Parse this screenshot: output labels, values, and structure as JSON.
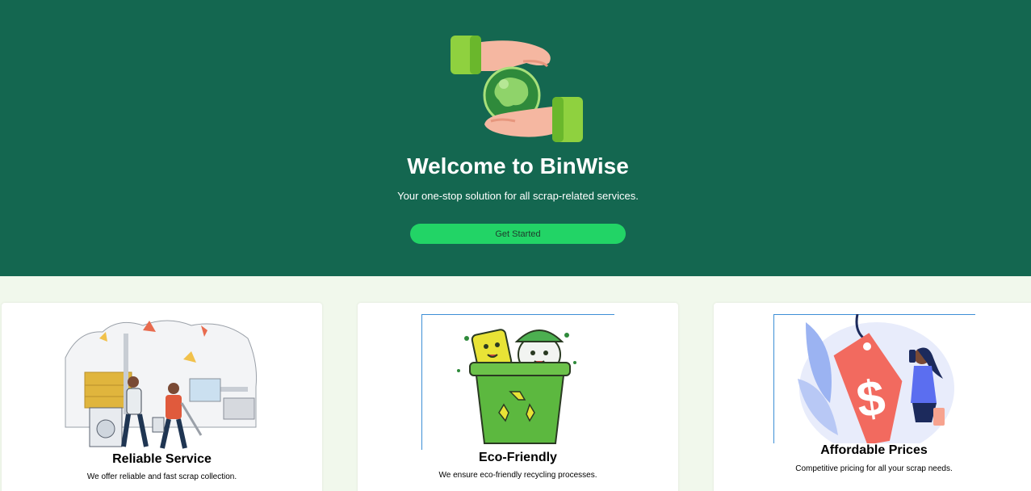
{
  "hero": {
    "title": "Welcome to BinWise",
    "subtitle": "Your one-stop solution for all scrap-related services.",
    "cta_label": "Get Started",
    "logo_icon": "hands-globe-icon"
  },
  "features": [
    {
      "title": "Reliable Service",
      "description": "We offer reliable and fast scrap collection.",
      "icon": "scrap-collection-illustration"
    },
    {
      "title": "Eco-Friendly",
      "description": "We ensure eco-friendly recycling processes.",
      "icon": "recycle-bin-illustration"
    },
    {
      "title": "Affordable Prices",
      "description": "Competitive pricing for all your scrap needs.",
      "icon": "price-tag-illustration"
    }
  ],
  "colors": {
    "hero_bg": "#146750",
    "page_bg": "#f1f8ec",
    "accent": "#22d466",
    "card_bg": "#ffffff"
  }
}
